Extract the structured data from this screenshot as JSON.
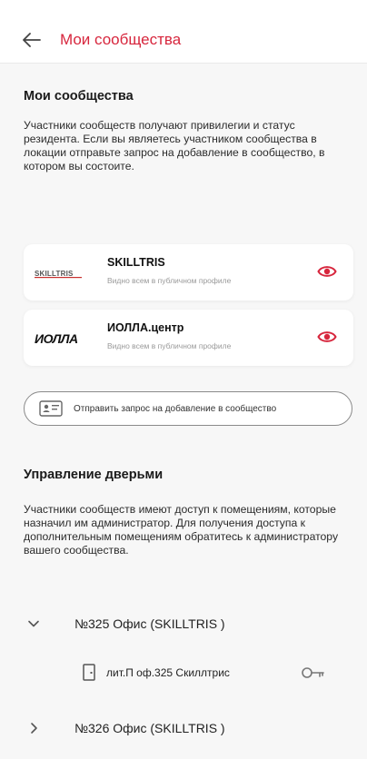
{
  "top_partial_text": "",
  "appbar": {
    "title": "Мои сообщества"
  },
  "communities": {
    "title": "Мои сообщества",
    "description": "Участники сообществ получают привилегии и статус резидента. Если вы являетесь участником сообщества в локации отправьте запрос на добавление в сообщество, в котором вы состоите.",
    "items": [
      {
        "name": "SKILLTRIS",
        "visibility": "Видно всем в публичном профиле",
        "logo_text": "SKILLTRIS",
        "icon": "eye-icon"
      },
      {
        "name": "ИОЛЛА.центр",
        "visibility": "Видно всем в публичном профиле",
        "logo_text": "ИОЛЛА",
        "icon": "eye-icon"
      }
    ],
    "request_button": "Отправить запрос на добавление в сообщество"
  },
  "doors": {
    "title": "Управление дверьми",
    "description": "Участники сообществ имеют доступ к помещениям, которые назначил им администратор. Для получения доступа к дополнительным помещениям обратитесь к администратору вашего сообщества.",
    "groups": [
      {
        "label": "№325 Офис  (SKILLTRIS )",
        "expanded": true,
        "rooms": [
          {
            "label": "лит.П оф.325 Скиллтрис"
          }
        ]
      },
      {
        "label": "№326 Офис  (SKILLTRIS )",
        "expanded": false,
        "rooms": []
      }
    ]
  },
  "colors": {
    "accent": "#d7263d",
    "background": "#f7f7f7",
    "card": "#ffffff"
  }
}
